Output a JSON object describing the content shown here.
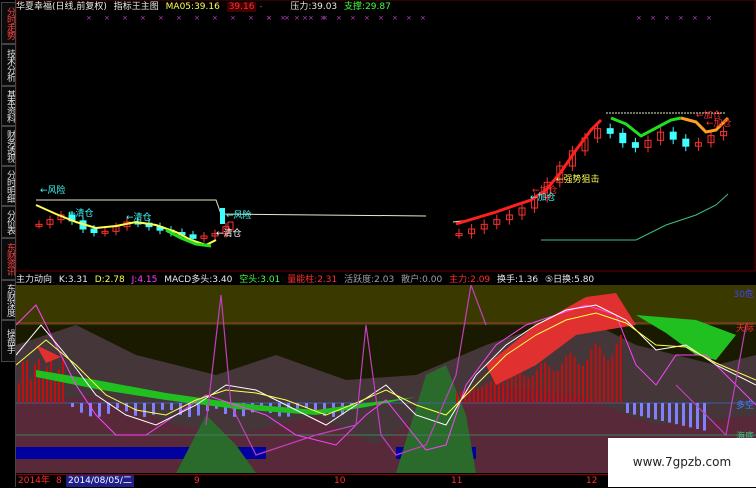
{
  "sidebar": {
    "tabs": [
      {
        "label": "分时走势",
        "active": false
      },
      {
        "label": "技术分析",
        "active": true
      },
      {
        "label": "基本资料",
        "active": false
      },
      {
        "label": "财务透视",
        "active": false
      },
      {
        "label": "分时明细",
        "active": false
      },
      {
        "label": "分价表",
        "active": false
      },
      {
        "label": "东财资讯",
        "active": false
      },
      {
        "label": "东财深度",
        "active": false
      },
      {
        "label": "操盘手",
        "active": false
      }
    ]
  },
  "header_main": {
    "title": "华夏幸福(日线,前复权)",
    "indicator": "指标王主图",
    "ma_label": "MA05:",
    "ma_value": "39.16",
    "ma_value2": "39.16",
    "ma_dash": "-",
    "pressure_label": "压力:",
    "pressure_value": "39.03",
    "support_label": "支撑:",
    "support_value": "29.87"
  },
  "header_sub": {
    "title": "主力动向",
    "k_label": "K:",
    "k_value": "3.31",
    "d_label": "D:",
    "d_value": "2.78",
    "j_label": "J:",
    "j_value": "4.15",
    "macd_bull_label": "MACD多头:",
    "macd_bull_value": "3.40",
    "bear_label": "空头:",
    "bear_value": "3.01",
    "energy_label": "量能柱:",
    "energy_value": "2.31",
    "active_label": "活跃度:",
    "active_value": "2.03",
    "retail_label": "散户:",
    "retail_value": "0.00",
    "main_label": "主力:",
    "main_value": "2.09",
    "turnover_label": "换手:",
    "turnover_value": "1.36",
    "day_label": "⑤日换:",
    "day_value": "5.80"
  },
  "annotations": {
    "danger1": "←风险",
    "clear1": "←清仓",
    "clear2": "←清仓",
    "danger2": "←风险",
    "clear3": "←清仓",
    "add1": "←加仓",
    "strong": "←强势狙击",
    "add2": "←加仓",
    "add3": "←加仓",
    "add4": "←加仓"
  },
  "sub_levels": {
    "top": "30危",
    "sky": "天际",
    "mid": "多空",
    "sea": "海底"
  },
  "date_bar": {
    "year": "2014年",
    "y_sub": "8",
    "selected_date": "2014/08/05/二",
    "ticks": [
      "9",
      "10",
      "11",
      "12"
    ]
  },
  "watermark": "www.7gpzb.com",
  "colors": {
    "up": "#ff3030",
    "down": "#40ffff",
    "ma_up": "#ff2020",
    "ma_down": "#20e020",
    "yellow": "#ffff50",
    "pressure": "#e8e8c0",
    "support": "#40c080"
  },
  "chart_data": {
    "type": "line",
    "title": "华夏幸福(日线,前复权)",
    "candles_segment_1": {
      "x_start": "2014-08",
      "close": [
        31.2,
        31.6,
        32.0,
        31.5,
        30.8,
        30.5,
        30.6,
        31.0,
        31.4,
        31.3,
        31.0,
        30.7,
        30.5,
        30.3,
        30.0,
        30.2,
        30.4,
        31.0
      ]
    },
    "candles_segment_2": {
      "close": [
        30.4,
        30.8,
        31.2,
        31.6,
        32.0,
        32.6,
        33.5,
        34.8,
        36.2,
        37.5,
        38.6,
        39.4,
        39.0,
        38.2,
        37.8,
        38.4,
        39.1,
        38.5,
        37.9,
        38.2,
        38.8,
        39.16
      ]
    },
    "series": [
      {
        "name": "压力",
        "last": 39.03
      },
      {
        "name": "支撑",
        "last": 29.87
      }
    ]
  }
}
